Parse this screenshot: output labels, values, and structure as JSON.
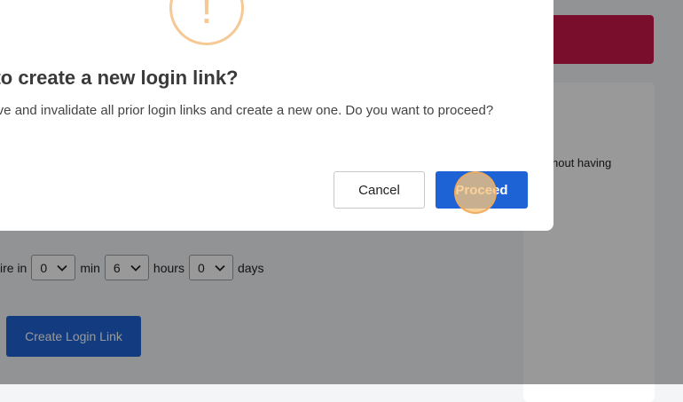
{
  "background": {
    "card_text": "hout having",
    "expire": {
      "label_prefix": "ire in",
      "minutes_value": "0",
      "minutes_label": "min",
      "hours_value": "6",
      "hours_label": "hours",
      "days_value": "0",
      "days_label": "days"
    },
    "create_button_label": "Create Login Link"
  },
  "dialog": {
    "icon_glyph": "!",
    "title": "t to create a new login link?",
    "message": "nove and invalidate all prior login links and create a new one. Do you want to proceed?",
    "cancel_label": "Cancel",
    "proceed_label": "Proceed"
  },
  "colors": {
    "primary": "#1e63d6",
    "banner": "#c8174a",
    "warning": "#f6c894"
  }
}
